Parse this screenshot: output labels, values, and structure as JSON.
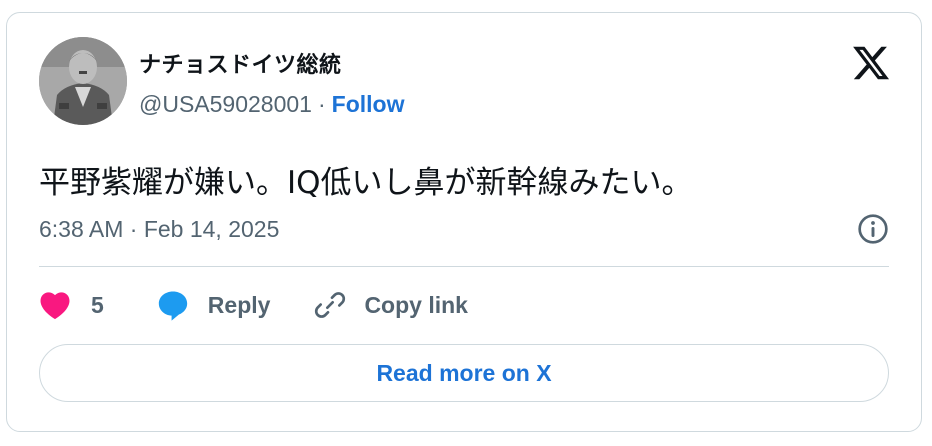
{
  "author": {
    "display_name": "ナチョスドイツ総統",
    "handle": "@USA59028001",
    "separator": "·",
    "follow_label": "Follow"
  },
  "tweet": {
    "text": "平野紫耀が嫌い。IQ低いし鼻が新幹線みたい。",
    "timestamp": "6:38 AM · Feb 14, 2025"
  },
  "actions": {
    "like_count": "5",
    "reply_label": "Reply",
    "copy_link_label": "Copy link"
  },
  "read_more_label": "Read more on X",
  "icons": [
    "x-logo-icon",
    "info-icon",
    "heart-icon",
    "reply-bubble-icon",
    "link-icon"
  ],
  "colors": {
    "link_blue": "#1d73d6",
    "heart": "#f91880",
    "reply_blue": "#1d9bf0",
    "muted": "#536471",
    "border": "#cfd9de"
  }
}
